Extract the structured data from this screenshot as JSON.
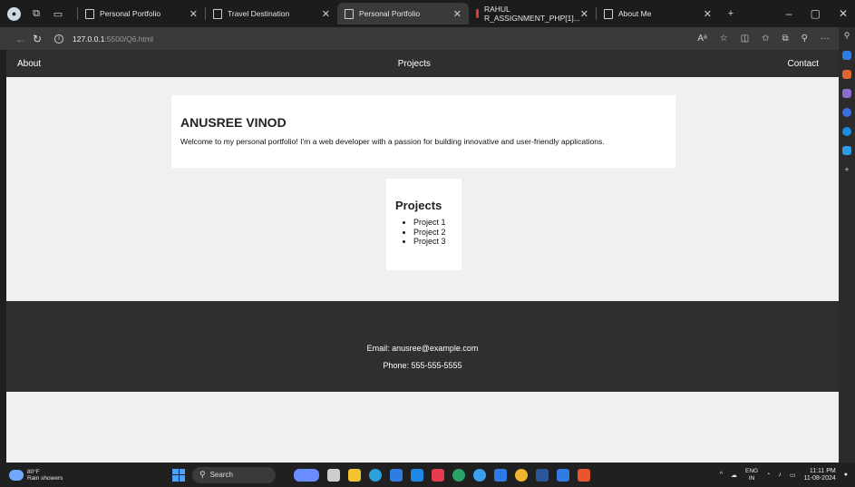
{
  "browser": {
    "tabs": [
      {
        "label": "Personal Portfolio",
        "active": false
      },
      {
        "label": "Travel Destination",
        "active": false
      },
      {
        "label": "Personal Portfolio",
        "active": true
      },
      {
        "label": "RAHUL R_ASSIGNMENT_PHP[1]...",
        "active": false
      },
      {
        "label": "About Me",
        "active": false
      }
    ],
    "url_host": "127.0.0.1",
    "url_path": ":5500/Q6.html"
  },
  "site": {
    "nav": {
      "about": "About",
      "projects": "Projects",
      "contact": "Contact"
    },
    "hero": {
      "name": "ANUSREE VINOD",
      "intro": "Welcome to my personal portfolio! I'm a web developer with a passion for building innovative and user-friendly applications."
    },
    "projects": {
      "heading": "Projects",
      "items": [
        "Project 1",
        "Project 2",
        "Project 3"
      ]
    },
    "footer": {
      "email": "Email: anusree@example.com",
      "phone": "Phone: 555-555-5555"
    }
  },
  "taskbar": {
    "weather_temp": "80°F",
    "weather_desc": "Rain showers",
    "search_label": "Search",
    "lang_top": "ENG",
    "lang_bottom": "IN",
    "time": "11:11 PM",
    "date": "11-08-2024"
  }
}
